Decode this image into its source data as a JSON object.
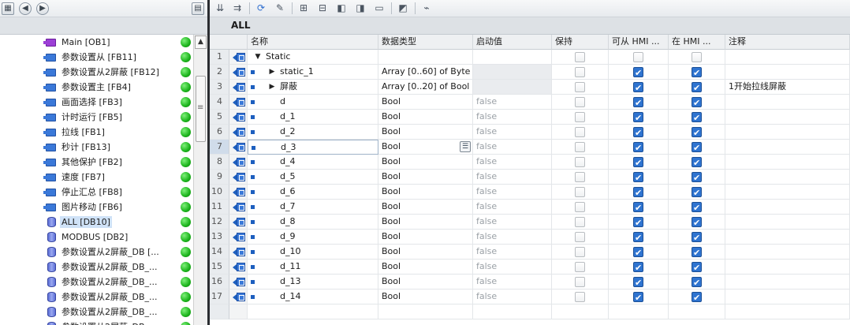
{
  "left_pane": {
    "nav_back_label": "◀",
    "nav_forward_label": "▶",
    "tree_items": [
      {
        "label": "Main [OB1]",
        "kind": "ob",
        "status": "ok"
      },
      {
        "label": "参数设置从 [FB11]",
        "kind": "fb",
        "status": "ok"
      },
      {
        "label": "参数设置从2屏蔽 [FB12]",
        "kind": "fb",
        "status": "ok"
      },
      {
        "label": "参数设置主 [FB4]",
        "kind": "fb",
        "status": "ok"
      },
      {
        "label": "画面选择 [FB3]",
        "kind": "fb",
        "status": "ok"
      },
      {
        "label": "计时运行 [FB5]",
        "kind": "fb",
        "status": "ok"
      },
      {
        "label": "拉线 [FB1]",
        "kind": "fb",
        "status": "ok"
      },
      {
        "label": "秒计 [FB13]",
        "kind": "fb",
        "status": "ok"
      },
      {
        "label": "其他保护 [FB2]",
        "kind": "fb",
        "status": "ok"
      },
      {
        "label": "速度 [FB7]",
        "kind": "fb",
        "status": "ok"
      },
      {
        "label": "停止汇总 [FB8]",
        "kind": "fb",
        "status": "ok"
      },
      {
        "label": "图片移动 [FB6]",
        "kind": "fb",
        "status": "ok"
      },
      {
        "label": "ALL [DB10]",
        "kind": "db",
        "status": "ok",
        "selected": true
      },
      {
        "label": "MODBUS [DB2]",
        "kind": "db",
        "status": "ok"
      },
      {
        "label": "参数设置从2屏蔽_DB [...",
        "kind": "db",
        "status": "ok"
      },
      {
        "label": "参数设置从2屏蔽_DB_...",
        "kind": "db",
        "status": "ok"
      },
      {
        "label": "参数设置从2屏蔽_DB_...",
        "kind": "db",
        "status": "ok"
      },
      {
        "label": "参数设置从2屏蔽_DB_...",
        "kind": "db",
        "status": "ok"
      },
      {
        "label": "参数设置从2屏蔽_DB_...",
        "kind": "db",
        "status": "ok"
      },
      {
        "label": "参数设置从2屏蔽_DB_...",
        "kind": "db",
        "status": "ok"
      }
    ]
  },
  "editor": {
    "block_title": "ALL",
    "columns": {
      "name": "名称",
      "datatype": "数据类型",
      "start_value": "启动值",
      "retain": "保持",
      "hmi_accessible": "可从 HMI ...",
      "hmi_visible": "在 HMI ...",
      "comment": "注释"
    },
    "rows": [
      {
        "num": "1",
        "level": 0,
        "expander": "▼",
        "name": "Static",
        "datatype": "",
        "start": "",
        "retain": false,
        "hmi1": false,
        "hmi2": false,
        "comment": "",
        "header": true
      },
      {
        "num": "2",
        "level": 1,
        "expander": "▶",
        "name": "static_1",
        "datatype": "Array [0..60] of Byte",
        "start": "",
        "retain": false,
        "hmi1": true,
        "hmi2": true,
        "comment": "",
        "shade_start": true
      },
      {
        "num": "3",
        "level": 1,
        "expander": "▶",
        "name": "屏蔽",
        "datatype": "Array [0..20] of Bool",
        "start": "",
        "retain": false,
        "hmi1": true,
        "hmi2": true,
        "comment": "1开始拉线屏蔽",
        "shade_start": true
      },
      {
        "num": "4",
        "level": 1,
        "expander": "",
        "name": "d",
        "datatype": "Bool",
        "start": "false",
        "retain": false,
        "hmi1": true,
        "hmi2": true,
        "comment": ""
      },
      {
        "num": "5",
        "level": 1,
        "expander": "",
        "name": "d_1",
        "datatype": "Bool",
        "start": "false",
        "retain": false,
        "hmi1": true,
        "hmi2": true,
        "comment": ""
      },
      {
        "num": "6",
        "level": 1,
        "expander": "",
        "name": "d_2",
        "datatype": "Bool",
        "start": "false",
        "retain": false,
        "hmi1": true,
        "hmi2": true,
        "comment": ""
      },
      {
        "num": "7",
        "level": 1,
        "expander": "",
        "name": "d_3",
        "datatype": "Bool",
        "start": "false",
        "retain": false,
        "hmi1": true,
        "hmi2": true,
        "comment": "",
        "selected": true
      },
      {
        "num": "8",
        "level": 1,
        "expander": "",
        "name": "d_4",
        "datatype": "Bool",
        "start": "false",
        "retain": false,
        "hmi1": true,
        "hmi2": true,
        "comment": ""
      },
      {
        "num": "9",
        "level": 1,
        "expander": "",
        "name": "d_5",
        "datatype": "Bool",
        "start": "false",
        "retain": false,
        "hmi1": true,
        "hmi2": true,
        "comment": ""
      },
      {
        "num": "10",
        "level": 1,
        "expander": "",
        "name": "d_6",
        "datatype": "Bool",
        "start": "false",
        "retain": false,
        "hmi1": true,
        "hmi2": true,
        "comment": ""
      },
      {
        "num": "11",
        "level": 1,
        "expander": "",
        "name": "d_7",
        "datatype": "Bool",
        "start": "false",
        "retain": false,
        "hmi1": true,
        "hmi2": true,
        "comment": ""
      },
      {
        "num": "12",
        "level": 1,
        "expander": "",
        "name": "d_8",
        "datatype": "Bool",
        "start": "false",
        "retain": false,
        "hmi1": true,
        "hmi2": true,
        "comment": ""
      },
      {
        "num": "13",
        "level": 1,
        "expander": "",
        "name": "d_9",
        "datatype": "Bool",
        "start": "false",
        "retain": false,
        "hmi1": true,
        "hmi2": true,
        "comment": ""
      },
      {
        "num": "14",
        "level": 1,
        "expander": "",
        "name": "d_10",
        "datatype": "Bool",
        "start": "false",
        "retain": false,
        "hmi1": true,
        "hmi2": true,
        "comment": ""
      },
      {
        "num": "15",
        "level": 1,
        "expander": "",
        "name": "d_11",
        "datatype": "Bool",
        "start": "false",
        "retain": false,
        "hmi1": true,
        "hmi2": true,
        "comment": ""
      },
      {
        "num": "16",
        "level": 1,
        "expander": "",
        "name": "d_13",
        "datatype": "Bool",
        "start": "false",
        "retain": false,
        "hmi1": true,
        "hmi2": true,
        "comment": ""
      },
      {
        "num": "17",
        "level": 1,
        "expander": "",
        "name": "d_14",
        "datatype": "Bool",
        "start": "false",
        "retain": false,
        "hmi1": true,
        "hmi2": true,
        "comment": ""
      }
    ]
  },
  "icons": {
    "toolbar": [
      "insert-row-icon",
      "add-row-icon",
      "update-interface-icon",
      "edit-icon",
      "expand-all-icon",
      "collapse-all-icon",
      "snapshot-icon",
      "copy-snapshot-icon",
      "load-start-values-icon",
      "monitor-icon",
      "keep-actual-values-icon"
    ],
    "row": "interface-member-icon",
    "status": "status-ok-icon"
  },
  "colors": {
    "status_ok": "#1bb31b",
    "checkbox_on": "#2f74d0",
    "selection": "#cfe2f7"
  }
}
